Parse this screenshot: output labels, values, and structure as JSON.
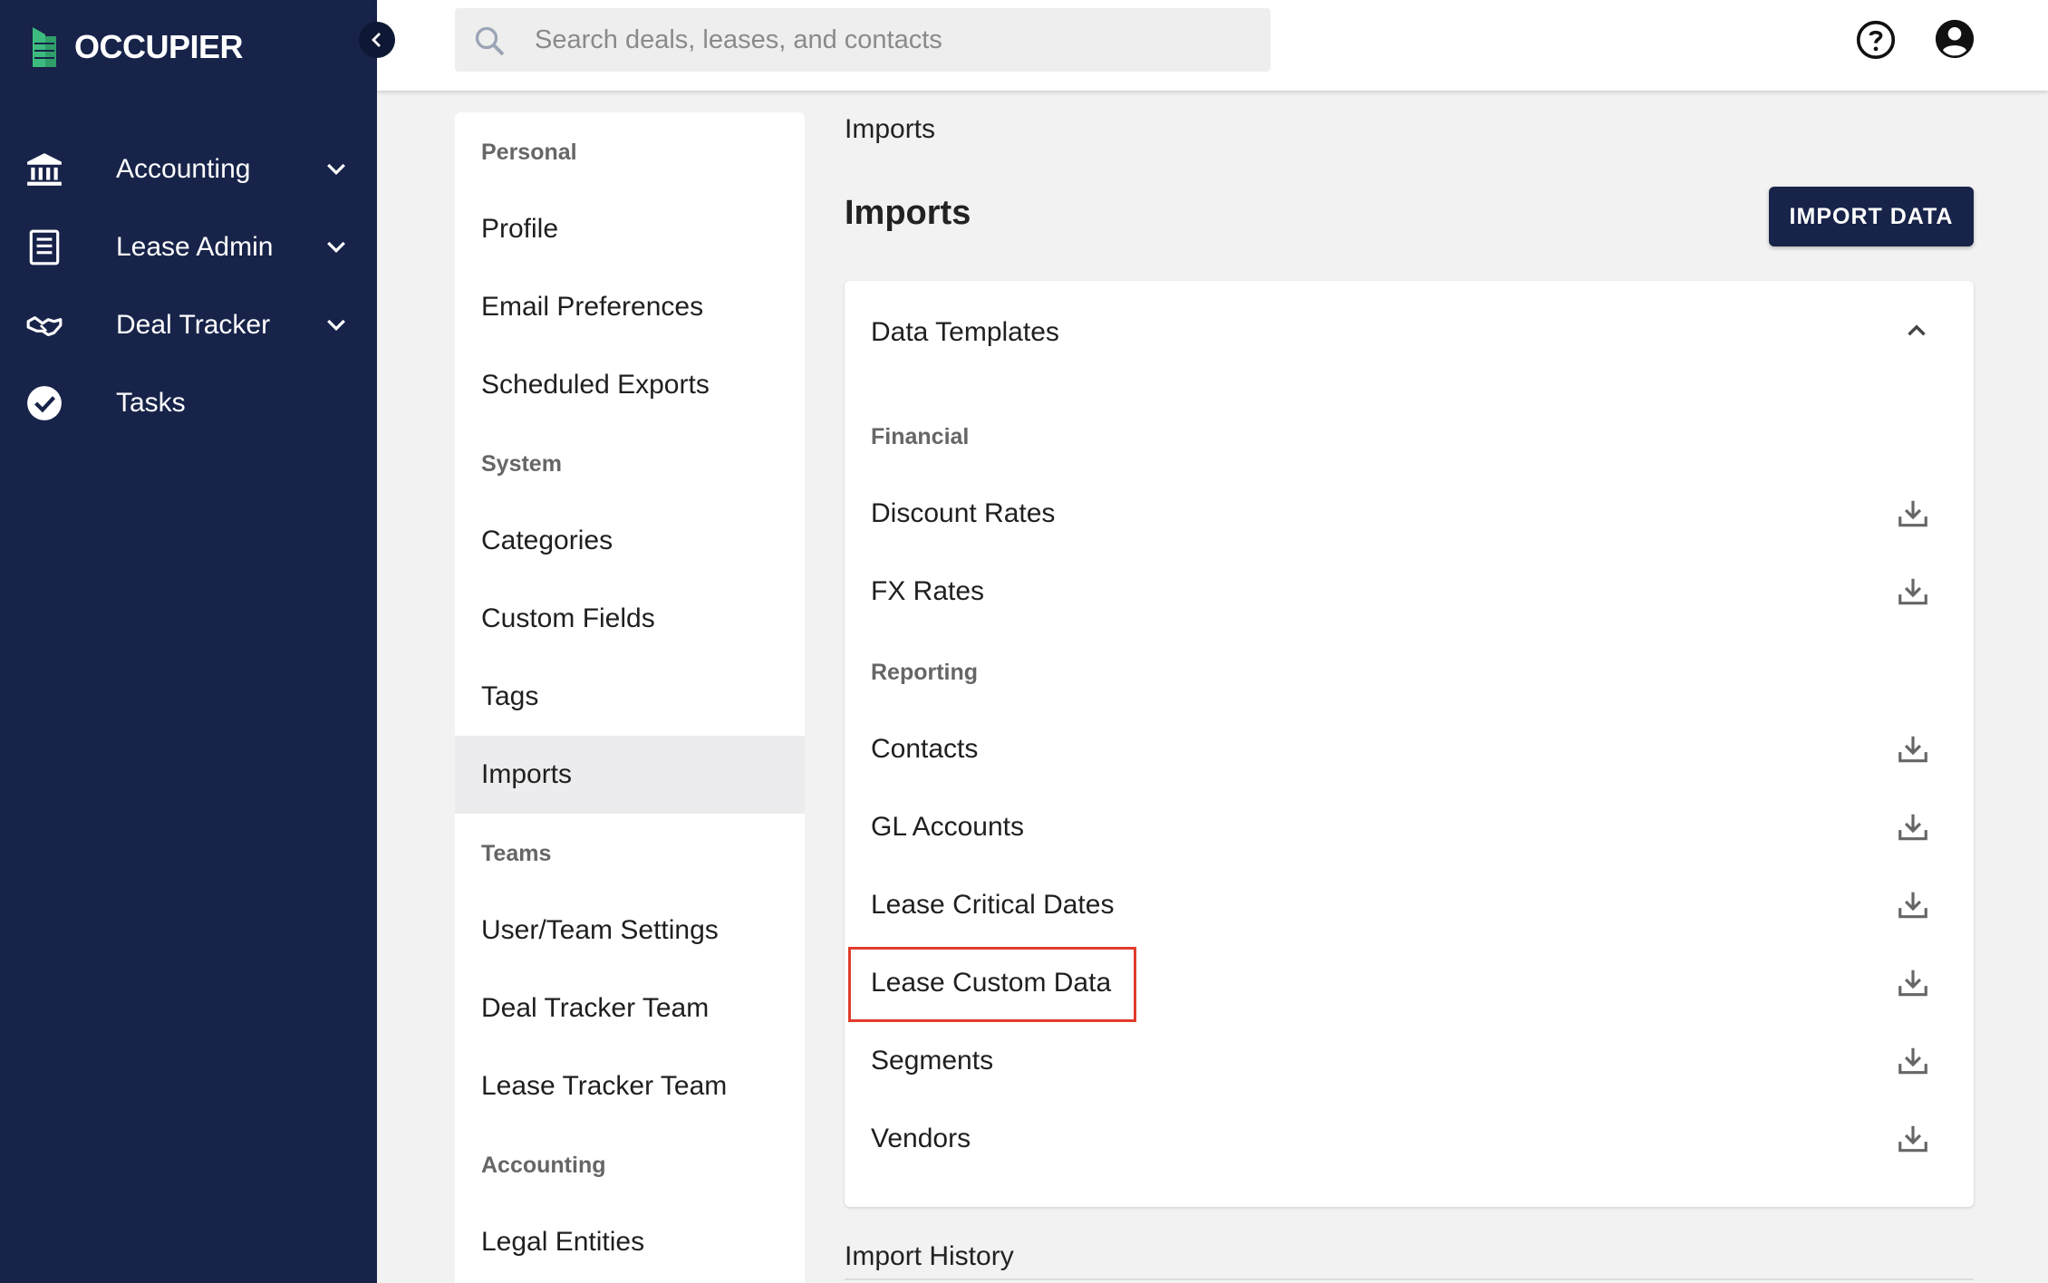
{
  "app": {
    "brand": "OCCUPIER"
  },
  "nav": {
    "items": [
      {
        "label": "Accounting",
        "icon": "bank-icon",
        "has_submenu": true
      },
      {
        "label": "Lease Admin",
        "icon": "document-icon",
        "has_submenu": true
      },
      {
        "label": "Deal Tracker",
        "icon": "handshake-icon",
        "has_submenu": true
      },
      {
        "label": "Tasks",
        "icon": "check-circle-icon",
        "has_submenu": false
      }
    ]
  },
  "topbar": {
    "search_placeholder": "Search deals, leases, and contacts"
  },
  "settings_menu": {
    "sections": [
      {
        "title": "Personal",
        "items": [
          "Profile",
          "Email Preferences",
          "Scheduled Exports"
        ]
      },
      {
        "title": "System",
        "items": [
          "Categories",
          "Custom Fields",
          "Tags",
          "Imports"
        ]
      },
      {
        "title": "Teams",
        "items": [
          "User/Team Settings",
          "Deal Tracker Team",
          "Lease Tracker Team"
        ]
      },
      {
        "title": "Accounting",
        "items": [
          "Legal Entities"
        ]
      }
    ],
    "active_item": "Imports"
  },
  "main": {
    "breadcrumb": "Imports",
    "title": "Imports",
    "import_button": "IMPORT DATA",
    "templates": {
      "title": "Data Templates",
      "expanded": true,
      "sections": [
        {
          "title": "Financial",
          "items": [
            "Discount Rates",
            "FX Rates"
          ]
        },
        {
          "title": "Reporting",
          "items": [
            "Contacts",
            "GL Accounts",
            "Lease Critical Dates",
            "Lease Custom Data",
            "Segments",
            "Vendors"
          ]
        }
      ],
      "highlighted_item": "Lease Custom Data"
    },
    "history_title": "Import History"
  },
  "colors": {
    "nav_bg": "#172349",
    "accent_green": "#3dbb7e",
    "highlight_border": "#e03c2c",
    "button_bg": "#172349"
  }
}
